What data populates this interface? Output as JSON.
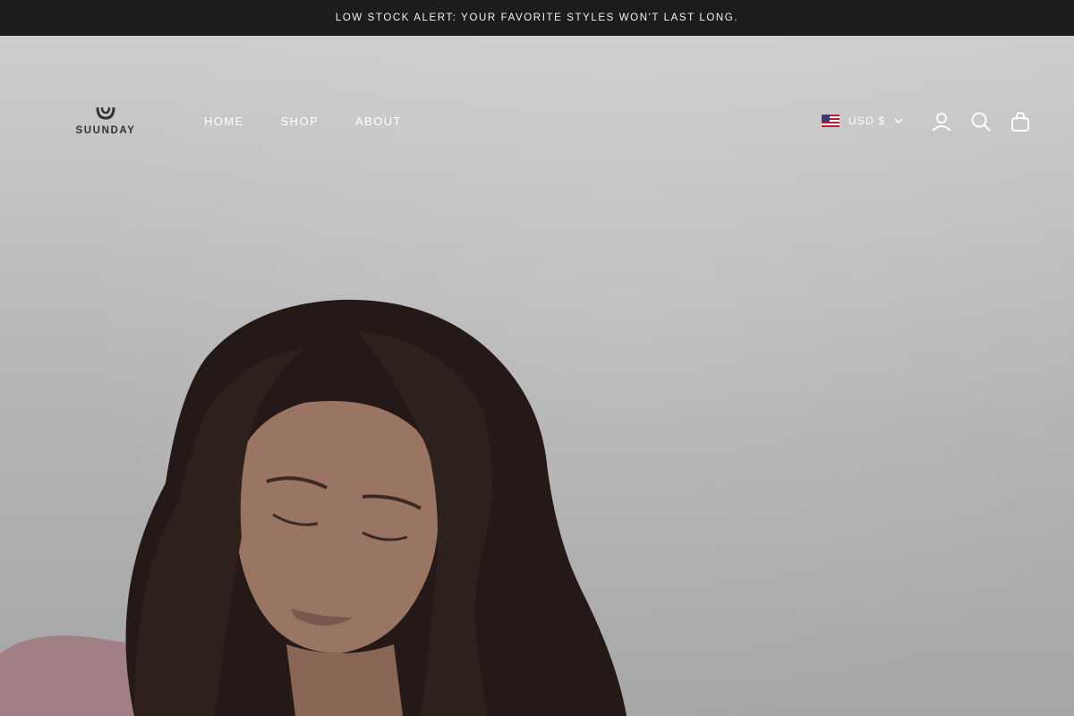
{
  "announcement": {
    "text": "LOW STOCK ALERT: YOUR FAVORITE STYLES WON'T LAST LONG."
  },
  "brand": {
    "name": "SUUNDAY"
  },
  "nav": {
    "items": [
      {
        "label": "HOME"
      },
      {
        "label": "SHOP"
      },
      {
        "label": "ABOUT"
      }
    ]
  },
  "currency": {
    "label": "USD $",
    "flag_icon": "us-flag-icon"
  },
  "header_icons": [
    "account-icon",
    "search-icon",
    "cart-bag-icon"
  ],
  "colors": {
    "announcement_bg": "#1c1c1c",
    "nav_text": "#ffffff",
    "hero_bg": "#bdbdbd",
    "hair": "#2a1e1c",
    "skin": "#9a7563",
    "top_pink": "#a07f85"
  }
}
